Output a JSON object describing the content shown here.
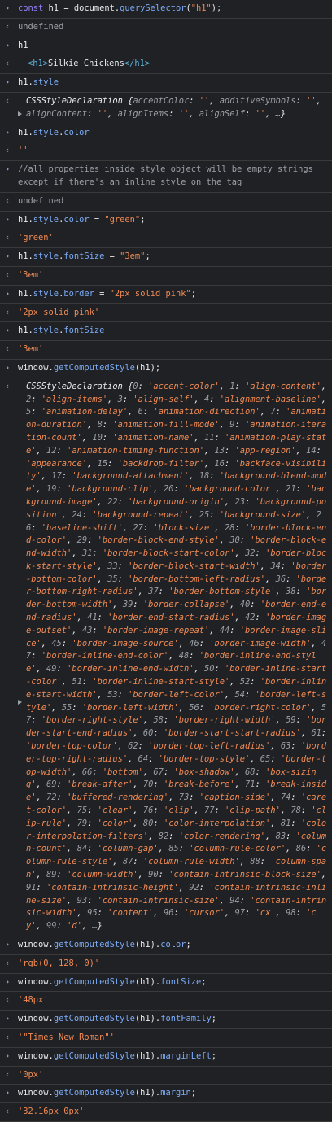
{
  "entries": [
    {
      "type": "input",
      "tokens": [
        [
          "kw",
          "const "
        ],
        [
          "id",
          "h1 = "
        ],
        [
          "id",
          "document"
        ],
        [
          "id",
          "."
        ],
        [
          "prop",
          "querySelector"
        ],
        [
          "id",
          "("
        ],
        [
          "str",
          "\"h1\""
        ],
        [
          "id",
          ");"
        ]
      ]
    },
    {
      "type": "output-undef",
      "text": "undefined"
    },
    {
      "type": "input",
      "tokens": [
        [
          "id",
          "h1"
        ]
      ]
    },
    {
      "type": "output-tag",
      "text": "<h1>Silkie Chickens</h1>",
      "open": "<h1>",
      "inner": "Silkie Chickens",
      "close": "</h1>"
    },
    {
      "type": "input",
      "tokens": [
        [
          "id",
          "h1"
        ],
        [
          "id",
          "."
        ],
        [
          "prop",
          "style"
        ]
      ]
    },
    {
      "type": "output-obj-small",
      "text": "CSSStyleDeclaration {accentColor: '', additiveSymbols: '', alignContent: '', alignItems: '', alignSelf: '', …}"
    },
    {
      "type": "input",
      "tokens": [
        [
          "id",
          "h1"
        ],
        [
          "id",
          "."
        ],
        [
          "prop",
          "style"
        ],
        [
          "id",
          "."
        ],
        [
          "prop",
          "color"
        ]
      ]
    },
    {
      "type": "output-str",
      "text": "''"
    },
    {
      "type": "input-comment",
      "text": "//all properties inside style object will be empty strings except if there's an inline style on the tag"
    },
    {
      "type": "output-undef",
      "text": "undefined"
    },
    {
      "type": "input",
      "tokens": [
        [
          "id",
          "h1"
        ],
        [
          "id",
          "."
        ],
        [
          "prop",
          "style"
        ],
        [
          "id",
          "."
        ],
        [
          "prop",
          "color"
        ],
        [
          "id",
          " = "
        ],
        [
          "str",
          "\"green\""
        ],
        [
          "id",
          ";"
        ]
      ]
    },
    {
      "type": "output-str",
      "text": "'green'"
    },
    {
      "type": "input",
      "tokens": [
        [
          "id",
          "h1"
        ],
        [
          "id",
          "."
        ],
        [
          "prop",
          "style"
        ],
        [
          "id",
          "."
        ],
        [
          "prop",
          "fontSize"
        ],
        [
          "id",
          " = "
        ],
        [
          "str",
          "\"3em\""
        ],
        [
          "id",
          ";"
        ]
      ]
    },
    {
      "type": "output-str",
      "text": "'3em'"
    },
    {
      "type": "input",
      "tokens": [
        [
          "id",
          "h1"
        ],
        [
          "id",
          "."
        ],
        [
          "prop",
          "style"
        ],
        [
          "id",
          "."
        ],
        [
          "prop",
          "border"
        ],
        [
          "id",
          " = "
        ],
        [
          "str",
          "\"2px solid pink\""
        ],
        [
          "id",
          ";"
        ]
      ]
    },
    {
      "type": "output-str",
      "text": "'2px solid pink'"
    },
    {
      "type": "input",
      "tokens": [
        [
          "id",
          "h1"
        ],
        [
          "id",
          "."
        ],
        [
          "prop",
          "style"
        ],
        [
          "id",
          "."
        ],
        [
          "prop",
          "fontSize"
        ]
      ]
    },
    {
      "type": "output-str",
      "text": "'3em'"
    },
    {
      "type": "input",
      "tokens": [
        [
          "id",
          "window"
        ],
        [
          "id",
          "."
        ],
        [
          "prop",
          "getComputedStyle"
        ],
        [
          "id",
          "(h1);"
        ]
      ]
    },
    {
      "type": "output-obj-big",
      "text": "CSSStyleDeclaration {0: 'accent-color', 1: 'align-content', 2: 'align-items', 3: 'align-self', 4: 'alignment-baseline', 5: 'animation-delay', 6: 'animation-direction', 7: 'animation-duration', 8: 'animation-fill-mode', 9: 'animation-iteration-count', 10: 'animation-name', 11: 'animation-play-state', 12: 'animation-timing-function', 13: 'app-region', 14: 'appearance', 15: 'backdrop-filter', 16: 'backface-visibility', 17: 'background-attachment', 18: 'background-blend-mode', 19: 'background-clip', 20: 'background-color', 21: 'background-image', 22: 'background-origin', 23: 'background-position', 24: 'background-repeat', 25: 'background-size', 26: 'baseline-shift', 27: 'block-size', 28: 'border-block-end-color', 29: 'border-block-end-style', 30: 'border-block-end-width', 31: 'border-block-start-color', 32: 'border-block-start-style', 33: 'border-block-start-width', 34: 'border-bottom-color', 35: 'border-bottom-left-radius', 36: 'border-bottom-right-radius', 37: 'border-bottom-style', 38: 'border-bottom-width', 39: 'border-collapse', 40: 'border-end-end-radius', 41: 'border-end-start-radius', 42: 'border-image-outset', 43: 'border-image-repeat', 44: 'border-image-slice', 45: 'border-image-source', 46: 'border-image-width', 47: 'border-inline-end-color', 48: 'border-inline-end-style', 49: 'border-inline-end-width', 50: 'border-inline-start-color', 51: 'border-inline-start-style', 52: 'border-inline-start-width', 53: 'border-left-color', 54: 'border-left-style', 55: 'border-left-width', 56: 'border-right-color', 57: 'border-right-style', 58: 'border-right-width', 59: 'border-start-end-radius', 60: 'border-start-start-radius', 61: 'border-top-color', 62: 'border-top-left-radius', 63: 'border-top-right-radius', 64: 'border-top-style', 65: 'border-top-width', 66: 'bottom', 67: 'box-shadow', 68: 'box-sizing', 69: 'break-after', 70: 'break-before', 71: 'break-inside', 72: 'buffered-rendering', 73: 'caption-side', 74: 'caret-color', 75: 'clear', 76: 'clip', 77: 'clip-path', 78: 'clip-rule', 79: 'color', 80: 'color-interpolation', 81: 'color-interpolation-filters', 82: 'color-rendering', 83: 'column-count', 84: 'column-gap', 85: 'column-rule-color', 86: 'column-rule-style', 87: 'column-rule-width', 88: 'column-span', 89: 'column-width', 90: 'contain-intrinsic-block-size', 91: 'contain-intrinsic-height', 92: 'contain-intrinsic-inline-size', 93: 'contain-intrinsic-size', 94: 'contain-intrinsic-width', 95: 'content', 96: 'cursor', 97: 'cx', 98: 'cy', 99: 'd', …}"
    },
    {
      "type": "input",
      "tokens": [
        [
          "id",
          "window"
        ],
        [
          "id",
          "."
        ],
        [
          "prop",
          "getComputedStyle"
        ],
        [
          "id",
          "(h1)."
        ],
        [
          "prop",
          "color"
        ],
        [
          "id",
          ";"
        ]
      ]
    },
    {
      "type": "output-str",
      "text": "'rgb(0, 128, 0)'"
    },
    {
      "type": "input",
      "tokens": [
        [
          "id",
          "window"
        ],
        [
          "id",
          "."
        ],
        [
          "prop",
          "getComputedStyle"
        ],
        [
          "id",
          "(h1)."
        ],
        [
          "prop",
          "fontSize"
        ],
        [
          "id",
          ";"
        ]
      ]
    },
    {
      "type": "output-str",
      "text": "'48px'"
    },
    {
      "type": "input",
      "tokens": [
        [
          "id",
          "window"
        ],
        [
          "id",
          "."
        ],
        [
          "prop",
          "getComputedStyle"
        ],
        [
          "id",
          "(h1)."
        ],
        [
          "prop",
          "fontFamily"
        ],
        [
          "id",
          ";"
        ]
      ]
    },
    {
      "type": "output-str",
      "text": "'\"Times New Roman\"'"
    },
    {
      "type": "input",
      "tokens": [
        [
          "id",
          "window"
        ],
        [
          "id",
          "."
        ],
        [
          "prop",
          "getComputedStyle"
        ],
        [
          "id",
          "(h1)."
        ],
        [
          "prop",
          "marginLeft"
        ],
        [
          "id",
          ";"
        ]
      ]
    },
    {
      "type": "output-str",
      "text": "'0px'"
    },
    {
      "type": "input",
      "tokens": [
        [
          "id",
          "window"
        ],
        [
          "id",
          "."
        ],
        [
          "prop",
          "getComputedStyle"
        ],
        [
          "id",
          "(h1)."
        ],
        [
          "prop",
          "margin"
        ],
        [
          "id",
          ";"
        ]
      ]
    },
    {
      "type": "output-str",
      "text": "'32.16px 0px'"
    }
  ],
  "icons": {
    "prompt": "chevron-right-icon",
    "return": "return-arrow-icon",
    "expand": "expand-triangle-icon"
  },
  "colors": {
    "background": "#202124",
    "prompt": "#8ab4f8",
    "keyword": "#9980ff",
    "property": "#7cacf8",
    "string": "#f28b54",
    "muted": "#9aa0a6",
    "text": "#e8eaed",
    "tag": "#5db0d7",
    "divider": "#3a3a3a"
  }
}
